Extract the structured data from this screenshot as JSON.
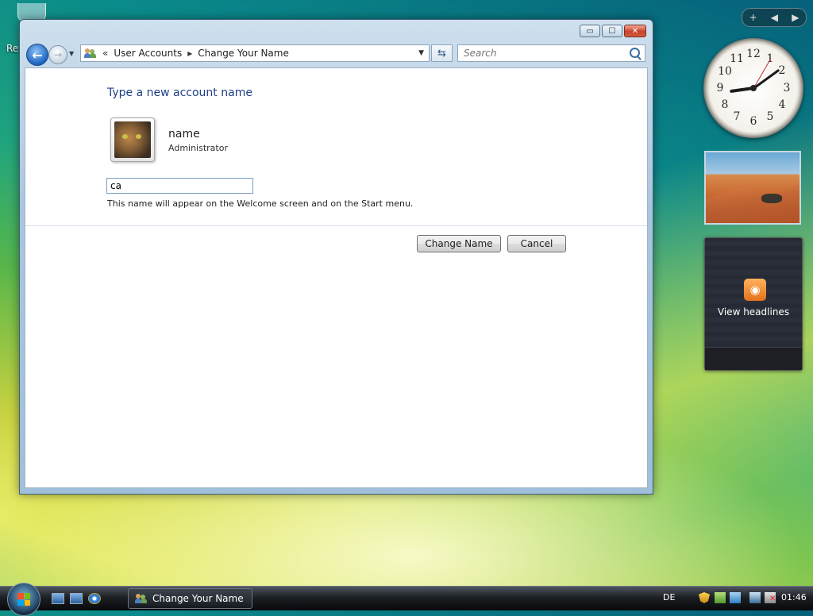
{
  "desktop": {
    "icon_label": "Re"
  },
  "window": {
    "title": "Change Your Name",
    "controls": {
      "minimize": "▭",
      "maximize": "☐",
      "close": "✕"
    },
    "nav": {
      "back_glyph": "←",
      "forward_glyph": "→",
      "address": {
        "prefix": "«",
        "crumbs": [
          "User Accounts",
          "Change Your Name"
        ],
        "separator": "▸"
      },
      "search_placeholder": "Search"
    },
    "content": {
      "heading": "Type a new account name",
      "user": {
        "name": "name",
        "role": "Administrator"
      },
      "input_value": "ca",
      "hint": "This name will appear on the Welcome screen and on the Start menu.",
      "buttons": {
        "change": "Change Name",
        "cancel": "Cancel"
      }
    }
  },
  "sidebar": {
    "toolbar": {
      "add": "+",
      "prev": "◀",
      "next": "▶"
    },
    "clock": {
      "numbers": [
        "12",
        "1",
        "2",
        "3",
        "4",
        "5",
        "6",
        "7",
        "8",
        "9",
        "10",
        "11"
      ]
    },
    "feed_label": "View headlines"
  },
  "taskbar": {
    "task_button": "Change Your Name",
    "language": "DE",
    "time": "01:46"
  },
  "colors": {
    "heading": "#1e3e86",
    "close_button": "#c9432b",
    "rss": "#e6701c"
  },
  "icons": [
    "recycle-bin-icon",
    "back-icon",
    "forward-icon",
    "user-accounts-icon",
    "refresh-icon",
    "search-icon",
    "rss-icon",
    "start-orb-icon",
    "show-desktop-icon",
    "switch-windows-icon",
    "internet-explorer-icon",
    "security-shield-icon",
    "network-icon",
    "update-icon",
    "volume-muted-icon"
  ]
}
